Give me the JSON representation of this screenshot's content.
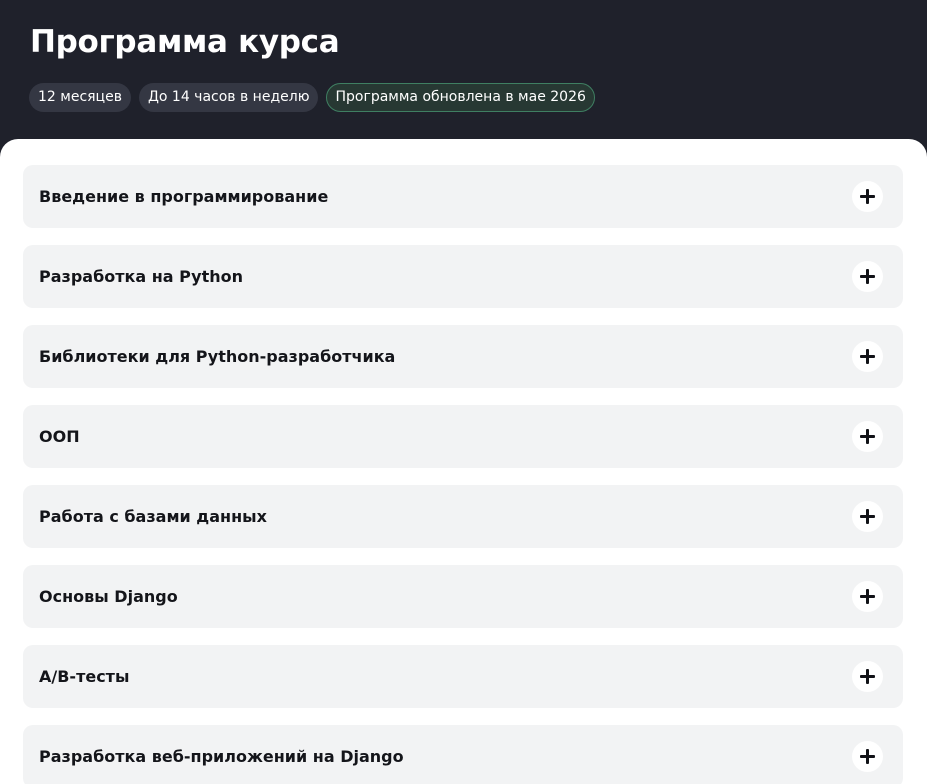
{
  "header": {
    "title": "Программа курса",
    "chips": [
      {
        "label": "12 месяцев"
      },
      {
        "label": "До 14 часов в неделю"
      },
      {
        "label": "Программа обновлена в мае 2026"
      }
    ]
  },
  "modules": [
    {
      "title": "Введение в программирование",
      "icon": "plus-icon"
    },
    {
      "title": "Разработка на Python",
      "icon": "plus-icon"
    },
    {
      "title": "Библиотеки для Python-разработчика",
      "icon": "plus-icon"
    },
    {
      "title": "ООП",
      "icon": "plus-icon"
    },
    {
      "title": "Работа с базами данных",
      "icon": "plus-icon"
    },
    {
      "title": "Основы Django",
      "icon": "plus-icon"
    },
    {
      "title": "A/B-тесты",
      "icon": "plus-icon"
    },
    {
      "title": "Разработка веб-приложений на Django",
      "icon": "plus-icon"
    }
  ],
  "colors": {
    "header_background": "#1f212b",
    "chip_background": "#343743",
    "highlight_chip_border": "#3f7f62",
    "card_background": "#f2f3f4",
    "text_dark": "#14151a"
  }
}
